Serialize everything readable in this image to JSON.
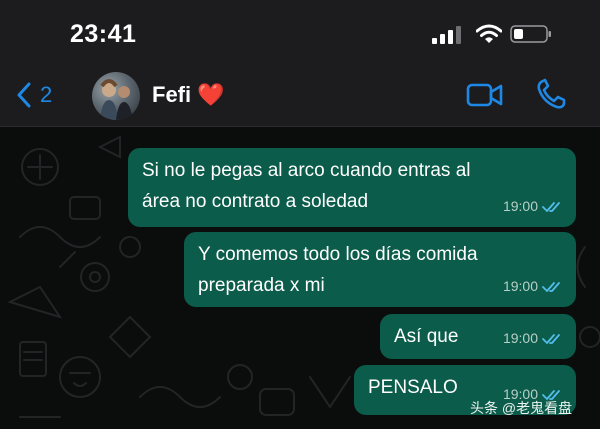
{
  "status_bar": {
    "time": "23:41"
  },
  "header": {
    "back_count": "2",
    "contact_name": "Fefi ❤️"
  },
  "messages": [
    {
      "lines": [
        "Si no le pegas al arco cuando entras al",
        "área no contrato a soledad"
      ],
      "time": "19:00",
      "status": "read"
    },
    {
      "lines": [
        "Y comemos todo los días comida",
        "preparada x mi"
      ],
      "time": "19:00",
      "status": "read"
    },
    {
      "lines": [
        "Así que"
      ],
      "time": "19:00",
      "status": "read"
    },
    {
      "lines": [
        "PENSALO"
      ],
      "time": "19:00",
      "status": "read"
    }
  ],
  "watermark": "头条 @老鬼看盘",
  "colors": {
    "accent": "#1e88e5",
    "outgoing_bubble": "#0b5c4a",
    "read_ticks": "#53bdeb",
    "header_bg": "#1c1c1e",
    "chat_bg": "#0b0c0c"
  }
}
